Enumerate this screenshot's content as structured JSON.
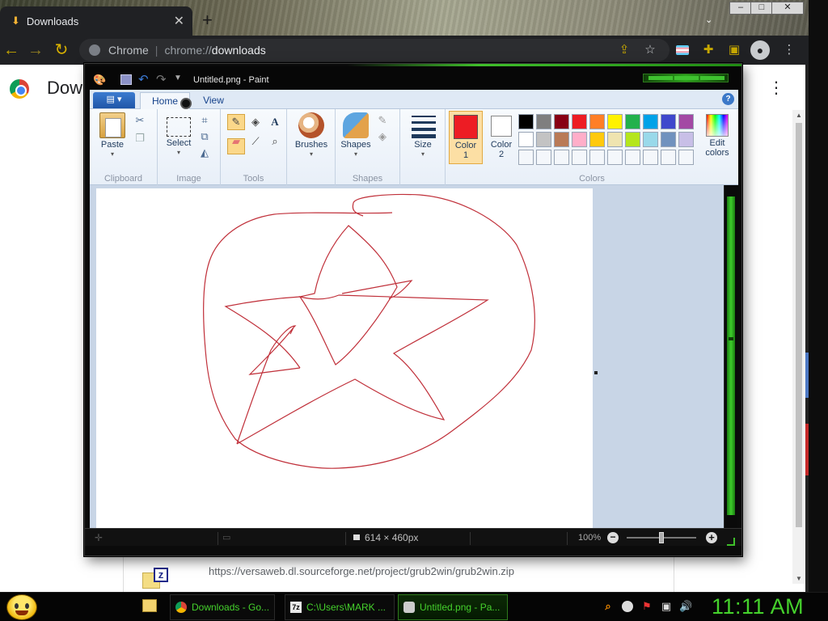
{
  "chrome": {
    "tab_title": "Downloads",
    "tab_close": "✕",
    "new_tab": "+",
    "omnibox_site": "Chrome",
    "omnibox_divider": "|",
    "omnibox_url_scheme": "chrome://",
    "omnibox_url_host": "downloads",
    "page_title": "Dow",
    "download_url": "https://versaweb.dl.sourceforge.net/project/grub2win/grub2win.zip"
  },
  "paint": {
    "window_title": "Untitled.png - Paint",
    "tabs": {
      "home": "Home",
      "view": "View"
    },
    "ribbon": {
      "paste": "Paste",
      "select": "Select",
      "brushes": "Brushes",
      "shapes": "Shapes",
      "size": "Size",
      "color1_line1": "Color",
      "color1_line2": "1",
      "color2_line1": "Color",
      "color2_line2": "2",
      "edit_colors_line1": "Edit",
      "edit_colors_line2": "colors"
    },
    "groups": {
      "clipboard": "Clipboard",
      "image": "Image",
      "tools": "Tools",
      "shapes": "Shapes",
      "colors": "Colors"
    },
    "color1": "#ed1c24",
    "color2": "#ffffff",
    "stroke_color": "#c0303a",
    "palette_row1": [
      "#000000",
      "#7f7f7f",
      "#880015",
      "#ed1c24",
      "#ff7f27",
      "#fff200",
      "#22b14c",
      "#00a2e8",
      "#3f48cc",
      "#a349a4"
    ],
    "palette_row2": [
      "#ffffff",
      "#c3c3c3",
      "#b97a57",
      "#ffaec9",
      "#ffc90e",
      "#efe4b0",
      "#b5e61d",
      "#99d9ea",
      "#7092be",
      "#c8bfe7"
    ],
    "palette_row3_count_empty": 10,
    "status": {
      "canvas_size": "614 × 460px",
      "zoom": "100%"
    }
  },
  "taskbar": {
    "buttons": [
      {
        "label": "Downloads - Go..."
      },
      {
        "label": "C:\\Users\\MARK ..."
      },
      {
        "label": "Untitled.png - Pa..."
      }
    ],
    "seven_zip_glyph": "7z",
    "clock": "11:11 AM"
  }
}
